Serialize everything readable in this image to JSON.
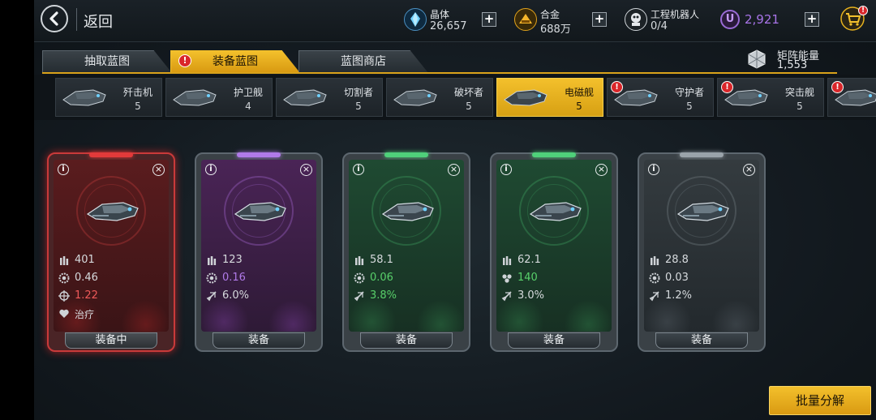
{
  "header": {
    "back_label": "返回",
    "resources": [
      {
        "name": "晶体",
        "value": "26,657"
      },
      {
        "name": "合金",
        "value": "688万"
      },
      {
        "name": "工程机器人",
        "value": "0/4"
      }
    ],
    "premium_icon_letter": "U",
    "premium_value": "2,921",
    "plus_symbol": "+",
    "cart_badge": "!"
  },
  "tabs": {
    "items": [
      {
        "label": "抽取蓝图",
        "active": false
      },
      {
        "label": "装备蓝图",
        "active": true,
        "badge": "!"
      },
      {
        "label": "蓝图商店",
        "active": false
      }
    ],
    "matrix_label": "矩阵能量",
    "matrix_value": "1,553"
  },
  "ships": [
    {
      "name": "歼击机",
      "count": "5",
      "active": false,
      "badge": false
    },
    {
      "name": "护卫舰",
      "count": "4",
      "active": false,
      "badge": false
    },
    {
      "name": "切割者",
      "count": "5",
      "active": false,
      "badge": false
    },
    {
      "name": "破坏者",
      "count": "5",
      "active": false,
      "badge": false
    },
    {
      "name": "电磁舰",
      "count": "5",
      "active": true,
      "badge": false
    },
    {
      "name": "守护者",
      "count": "5",
      "active": false,
      "badge": true
    },
    {
      "name": "突击舰",
      "count": "5",
      "active": false,
      "badge": true
    },
    {
      "name": "",
      "count": "",
      "active": false,
      "badge": true
    }
  ],
  "cards": [
    {
      "rarity": "red",
      "stats": [
        "401",
        "0.46",
        "1.22",
        "治疗"
      ],
      "button": "装备中",
      "selected": true
    },
    {
      "rarity": "purple",
      "stats": [
        "123",
        "0.16",
        "6.0%"
      ],
      "button": "装备",
      "selected": false
    },
    {
      "rarity": "green",
      "stats": [
        "58.1",
        "0.06",
        "3.8%"
      ],
      "button": "装备",
      "selected": false
    },
    {
      "rarity": "green",
      "stats": [
        "62.1",
        "140",
        "3.0%"
      ],
      "button": "装备",
      "selected": false
    },
    {
      "rarity": "gray",
      "stats": [
        "28.8",
        "0.03",
        "1.2%"
      ],
      "button": "装备",
      "selected": false
    }
  ],
  "card_icons": {
    "info": "i",
    "close": "×"
  },
  "footer": {
    "batch_label": "批量分解"
  },
  "colors": {
    "accent_gold": "#f3c02c",
    "red": "#e24a4a",
    "purple": "#b07ae8",
    "green": "#58d06a",
    "gray": "#c9cdd1"
  }
}
